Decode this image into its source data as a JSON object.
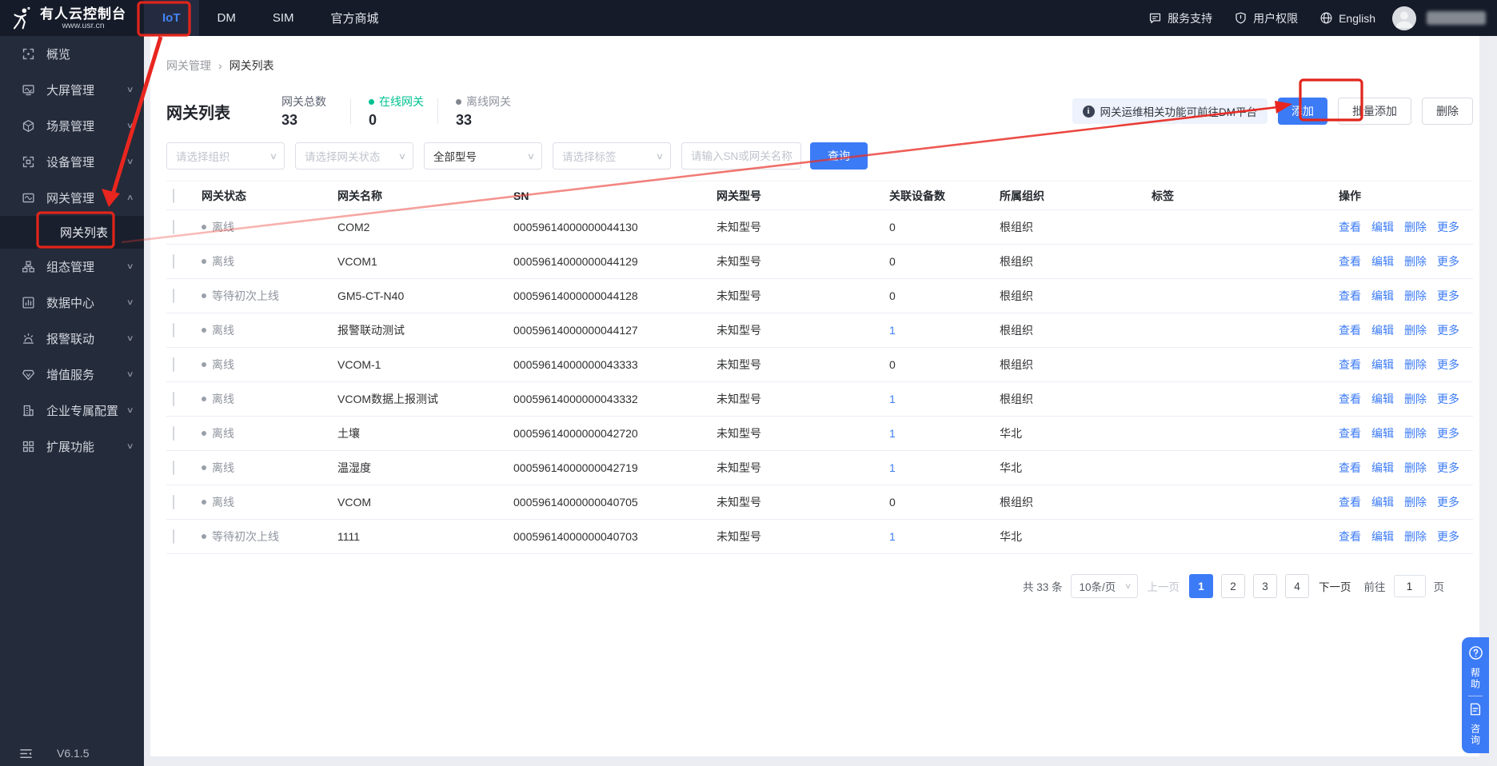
{
  "brand": {
    "title": "有人云控制台",
    "subtitle": "www.usr.cn"
  },
  "topnav": {
    "tabs": [
      {
        "label": "IoT",
        "active": true
      },
      {
        "label": "DM",
        "active": false
      },
      {
        "label": "SIM",
        "active": false
      },
      {
        "label": "官方商城",
        "active": false
      }
    ],
    "right": [
      {
        "label": "服务支持",
        "icon": "chat-icon"
      },
      {
        "label": "用户权限",
        "icon": "shield-icon"
      },
      {
        "label": "English",
        "icon": "globe-icon"
      }
    ]
  },
  "sidebar": {
    "items": [
      {
        "label": "概览",
        "icon": "overview"
      },
      {
        "label": "大屏管理",
        "icon": "screen",
        "chevron": "down"
      },
      {
        "label": "场景管理",
        "icon": "scene",
        "chevron": "down"
      },
      {
        "label": "设备管理",
        "icon": "device",
        "chevron": "down"
      },
      {
        "label": "网关管理",
        "icon": "gateway",
        "chevron": "up"
      },
      {
        "label": "网关列表",
        "sub": true,
        "active": true
      },
      {
        "label": "组态管理",
        "icon": "config",
        "chevron": "down"
      },
      {
        "label": "数据中心",
        "icon": "data",
        "chevron": "down"
      },
      {
        "label": "报警联动",
        "icon": "alarm",
        "chevron": "down"
      },
      {
        "label": "增值服务",
        "icon": "vas",
        "chevron": "down"
      },
      {
        "label": "企业专属配置",
        "icon": "enterprise",
        "chevron": "down"
      },
      {
        "label": "扩展功能",
        "icon": "extend",
        "chevron": "down"
      }
    ],
    "version": "V6.1.5"
  },
  "breadcrumb": {
    "items": [
      "网关管理",
      "网关列表"
    ],
    "separator": "›"
  },
  "page": {
    "title": "网关列表",
    "stats": [
      {
        "label": "网关总数",
        "value": "33",
        "dot": ""
      },
      {
        "label": "在线网关",
        "value": "0",
        "dot": "green"
      },
      {
        "label": "离线网关",
        "value": "33",
        "dot": "gray"
      }
    ],
    "notice": "网关运维相关功能可前往DM平台",
    "actions": [
      {
        "label": "添加",
        "primary": true
      },
      {
        "label": "批量添加",
        "primary": false
      },
      {
        "label": "删除",
        "primary": false
      }
    ]
  },
  "filters": {
    "selects": [
      {
        "placeholder": "请选择组织",
        "value": ""
      },
      {
        "placeholder": "请选择网关状态",
        "value": ""
      },
      {
        "placeholder": "",
        "value": "全部型号"
      },
      {
        "placeholder": "请选择标签",
        "value": ""
      }
    ],
    "input_placeholder": "请输入SN或网关名称",
    "search_label": "查询"
  },
  "table": {
    "columns": [
      "网关状态",
      "网关名称",
      "SN",
      "网关型号",
      "关联设备数",
      "所属组织",
      "标签",
      "操作"
    ],
    "row_actions": [
      "查看",
      "编辑",
      "删除",
      "更多"
    ],
    "rows": [
      {
        "status": "离线",
        "name": "COM2",
        "sn": "00059614000000044130",
        "model": "未知型号",
        "devices": "0",
        "org": "根组织",
        "tag": ""
      },
      {
        "status": "离线",
        "name": "VCOM1",
        "sn": "00059614000000044129",
        "model": "未知型号",
        "devices": "0",
        "org": "根组织",
        "tag": ""
      },
      {
        "status": "等待初次上线",
        "name": "GM5-CT-N40",
        "sn": "00059614000000044128",
        "model": "未知型号",
        "devices": "0",
        "org": "根组织",
        "tag": ""
      },
      {
        "status": "离线",
        "name": "报警联动测试",
        "sn": "00059614000000044127",
        "model": "未知型号",
        "devices": "1",
        "org": "根组织",
        "tag": ""
      },
      {
        "status": "离线",
        "name": "VCOM-1",
        "sn": "00059614000000043333",
        "model": "未知型号",
        "devices": "0",
        "org": "根组织",
        "tag": ""
      },
      {
        "status": "离线",
        "name": "VCOM数据上报测试",
        "sn": "00059614000000043332",
        "model": "未知型号",
        "devices": "1",
        "org": "根组织",
        "tag": ""
      },
      {
        "status": "离线",
        "name": "土壤",
        "sn": "00059614000000042720",
        "model": "未知型号",
        "devices": "1",
        "org": "华北",
        "tag": ""
      },
      {
        "status": "离线",
        "name": "温湿度",
        "sn": "00059614000000042719",
        "model": "未知型号",
        "devices": "1",
        "org": "华北",
        "tag": ""
      },
      {
        "status": "离线",
        "name": "VCOM",
        "sn": "00059614000000040705",
        "model": "未知型号",
        "devices": "0",
        "org": "根组织",
        "tag": ""
      },
      {
        "status": "等待初次上线",
        "name": "1111",
        "sn": "00059614000000040703",
        "model": "未知型号",
        "devices": "1",
        "org": "华北",
        "tag": ""
      }
    ]
  },
  "pagination": {
    "total": "共 33 条",
    "page_size": "10条/页",
    "prev": "上一页",
    "pages": [
      "1",
      "2",
      "3",
      "4"
    ],
    "active_page": "1",
    "next": "下一页",
    "goto_prefix": "前往",
    "goto_value": "1",
    "goto_suffix": "页"
  },
  "floating": {
    "help": "帮助",
    "consult": "咨询"
  },
  "colors": {
    "accent": "#3c7bf6",
    "green": "#00c292",
    "annotation_red": "#e8261f",
    "sidebar_bg": "#242b3a",
    "topbar_bg": "#161b29"
  }
}
